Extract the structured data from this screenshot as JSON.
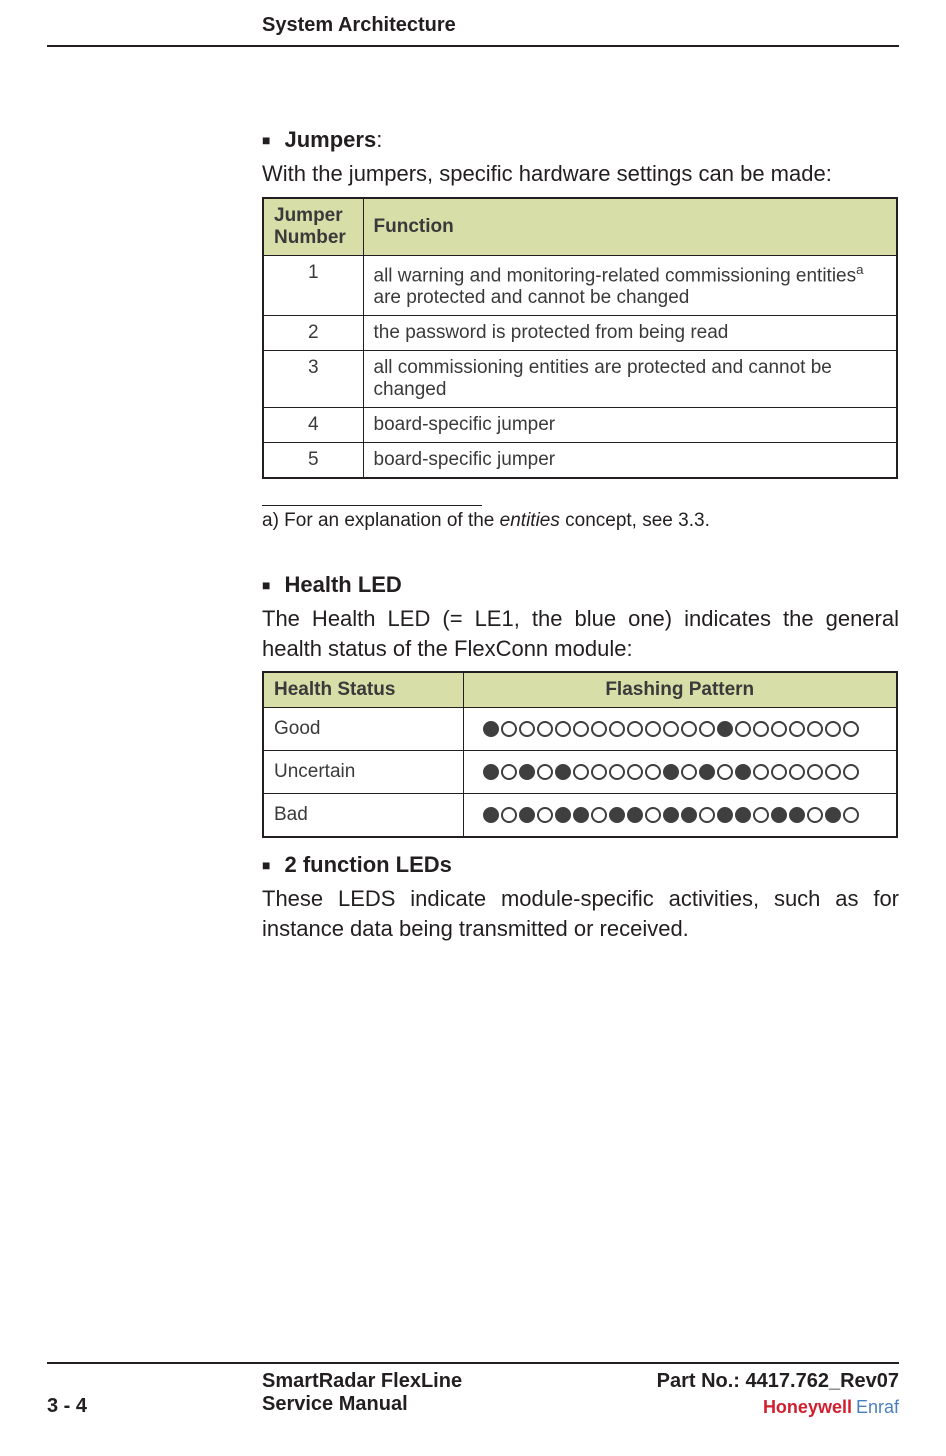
{
  "header": {
    "title": "System Architecture"
  },
  "sections": {
    "jumpers": {
      "title": "Jumpers",
      "colon": ":",
      "intro": "With the jumpers, specific hardware settings can be made:",
      "table": {
        "col1": "Jumper Number",
        "col2": "Function",
        "rows": [
          {
            "num": "1",
            "func_pre": "all warning and monitoring-related commissioning entities",
            "sup": "a",
            "func_post": " are protected and cannot be changed"
          },
          {
            "num": "2",
            "func": "the password is protected from being read"
          },
          {
            "num": "3",
            "func": "all commissioning entities are protected and cannot be changed"
          },
          {
            "num": "4",
            "func": "board-specific jumper"
          },
          {
            "num": "5",
            "func": "board-specific jumper"
          }
        ]
      },
      "footnote_pre": "a) For an explanation of the ",
      "footnote_em": "entities",
      "footnote_post": " concept, see 3.3."
    },
    "health": {
      "title": "Health LED",
      "intro": "The Health LED (= LE1, the blue one) indicates the general health status of the FlexConn module:",
      "table": {
        "col1": "Health Status",
        "col2": "Flashing Pattern",
        "rows": [
          {
            "status": "Good",
            "pattern": "100000000000010000000"
          },
          {
            "status": "Uncertain",
            "pattern": "101010000010101000000"
          },
          {
            "status": "Bad",
            "pattern": "101011011011011011010"
          }
        ]
      }
    },
    "func_leds": {
      "title": "2 function LEDs",
      "intro": "These LEDS indicate module-specific activities, such as for instance data being transmitted or received."
    }
  },
  "footer": {
    "page": "3 - 4",
    "title1": "SmartRadar FlexLine",
    "title2": "Service Manual",
    "partno": "Part No.: 4417.762_Rev07",
    "logo1": "Honeywell",
    "logo2": "Enraf"
  }
}
